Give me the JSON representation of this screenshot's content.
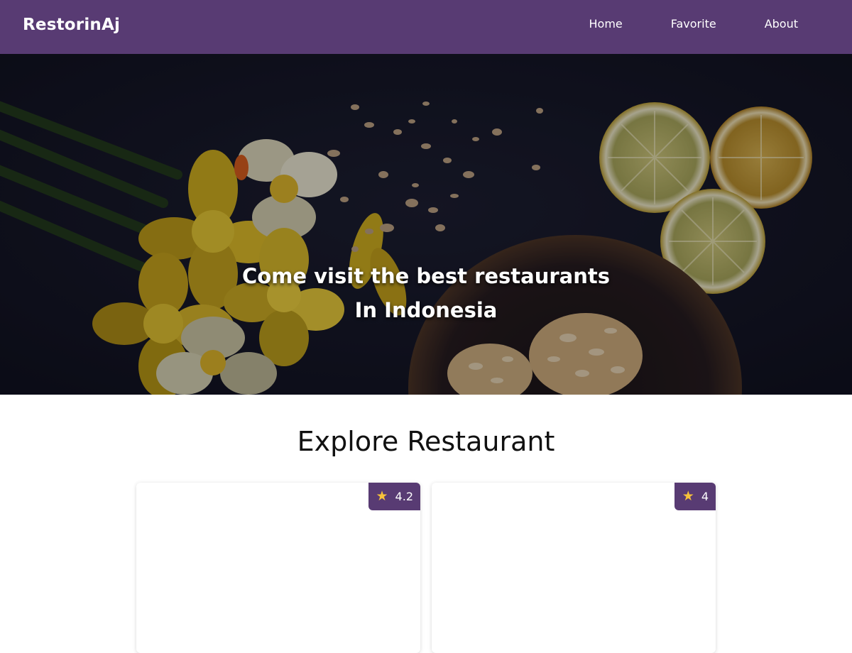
{
  "navbar": {
    "brand": "RestorinAj",
    "links": [
      "Home",
      "Favorite",
      "About"
    ]
  },
  "hero": {
    "line1": "Come visit the best restaurants",
    "line2": "In Indonesia"
  },
  "main": {
    "title": "Explore Restaurant",
    "cards": [
      {
        "rating": "4.2"
      },
      {
        "rating": "4"
      }
    ]
  },
  "colors": {
    "primary": "#583b73",
    "star": "#f7c23a",
    "hero_dark": "#141625"
  },
  "icons": {
    "rating": "star-icon"
  }
}
